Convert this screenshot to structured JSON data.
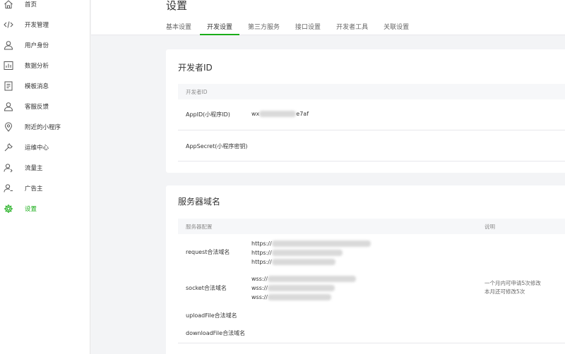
{
  "sidebar": {
    "items": [
      {
        "label": "首页",
        "icon": "home-icon"
      },
      {
        "label": "开发管理",
        "icon": "code-icon"
      },
      {
        "label": "用户身份",
        "icon": "user-icon"
      },
      {
        "label": "数据分析",
        "icon": "bar-chart-icon"
      },
      {
        "label": "模板消息",
        "icon": "document-icon"
      },
      {
        "label": "客服反馈",
        "icon": "customer-service-icon"
      },
      {
        "label": "附近的小程序",
        "icon": "location-pin-icon"
      },
      {
        "label": "运维中心",
        "icon": "wrench-icon"
      },
      {
        "label": "流量主",
        "icon": "user-traffic-icon"
      },
      {
        "label": "广告主",
        "icon": "user-advertiser-icon"
      },
      {
        "label": "设置",
        "icon": "gear-icon",
        "active": true
      }
    ]
  },
  "header": {
    "title": "设置",
    "tabs": [
      "基本设置",
      "开发设置",
      "第三方服务",
      "接口设置",
      "开发者工具",
      "关联设置"
    ],
    "active_tab": "开发设置"
  },
  "developer_id": {
    "title": "开发者ID",
    "table_header": "开发者ID",
    "appid_label": "AppID(小程序ID)",
    "appid_prefix": "wx",
    "appid_suffix": "e7af",
    "appsecret_label": "AppSecret(小程序密钥)"
  },
  "server_domain": {
    "title": "服务器域名",
    "header_config": "服务器配置",
    "header_note": "说明",
    "request_label": "request合法域名",
    "request_urls": [
      "https://",
      "https://",
      "https://"
    ],
    "socket_label": "socket合法域名",
    "socket_urls": [
      "wss://",
      "wss://",
      "wss://"
    ],
    "note_line1": "一个月内可申请5次修改",
    "note_line2": "本月还可修改5次",
    "upload_label": "uploadFile合法域名",
    "download_label": "downloadFile合法域名"
  },
  "colors": {
    "accent": "#1aad19"
  }
}
